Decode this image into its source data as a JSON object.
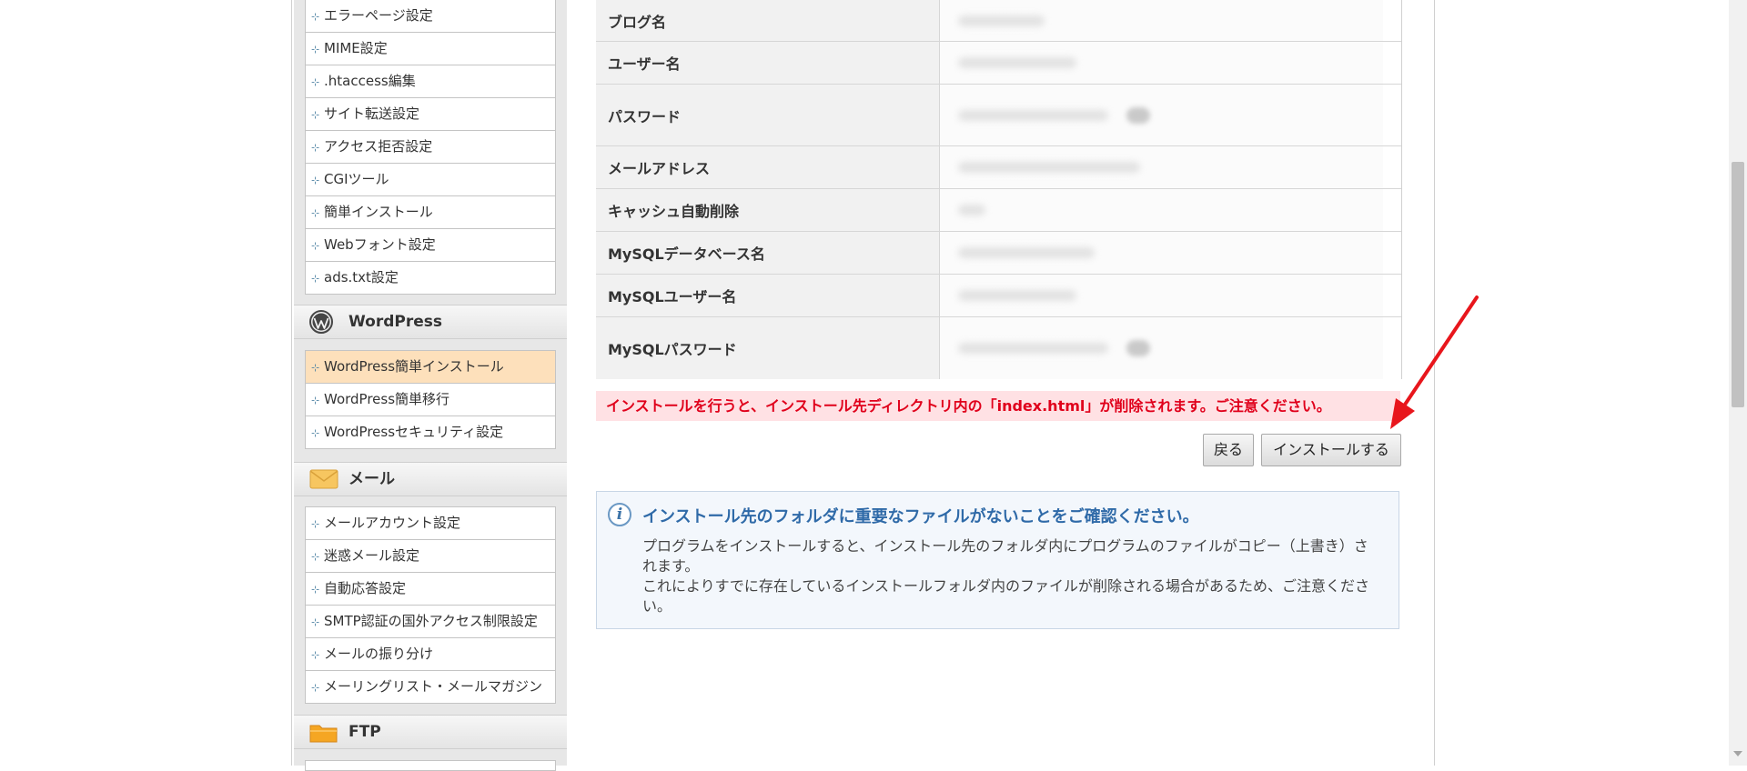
{
  "sidebar": {
    "server_items": [
      {
        "label": "エラーページ設定"
      },
      {
        "label": "MIME設定"
      },
      {
        "label": ".htaccess編集"
      },
      {
        "label": "サイト転送設定"
      },
      {
        "label": "アクセス拒否設定"
      },
      {
        "label": "CGIツール"
      },
      {
        "label": "簡単インストール"
      },
      {
        "label": "Webフォント設定"
      },
      {
        "label": "ads.txt設定"
      }
    ],
    "wordpress": {
      "title": "WordPress",
      "items": [
        {
          "label": "WordPress簡単インストール",
          "active": true
        },
        {
          "label": "WordPress簡単移行"
        },
        {
          "label": "WordPressセキュリティ設定"
        }
      ]
    },
    "mail": {
      "title": "メール",
      "items": [
        {
          "label": "メールアカウント設定"
        },
        {
          "label": "迷惑メール設定"
        },
        {
          "label": "自動応答設定"
        },
        {
          "label": "SMTP認証の国外アクセス制限設定"
        },
        {
          "label": "メールの振り分け"
        },
        {
          "label": "メーリングリスト・メールマガジン"
        }
      ]
    },
    "ftp": {
      "title": "FTP"
    },
    "bullet_glyph": "⊹"
  },
  "form": {
    "rows": [
      {
        "label": "ブログ名"
      },
      {
        "label": "ユーザー名"
      },
      {
        "label": "パスワード"
      },
      {
        "label": "メールアドレス"
      },
      {
        "label": "キャッシュ自動削除"
      },
      {
        "label": "MySQLデータベース名"
      },
      {
        "label": "MySQLユーザー名"
      },
      {
        "label": "MySQLパスワード"
      }
    ]
  },
  "warning": {
    "text": "インストールを行うと、インストール先ディレクトリ内の「index.html」が削除されます。ご注意ください。"
  },
  "buttons": {
    "back_label": "戻る",
    "install_label": "インストールする"
  },
  "info": {
    "icon": "i",
    "title": "インストール先のフォルダに重要なファイルがないことをご確認ください。",
    "line1": "プログラムをインストールすると、インストール先のフォルダ内にプログラムのファイルがコピー（上書き）されます。",
    "line2": "これによりすでに存在しているインストールフォルダ内のファイルが削除される場合があるため、ご注意ください。"
  },
  "colors": {
    "active_menu_bg": "#fde0bb",
    "warning_text": "#e0001b",
    "warning_bg": "#ffe1e4",
    "info_title": "#2f6aa8",
    "arrow": "#e8161c"
  }
}
